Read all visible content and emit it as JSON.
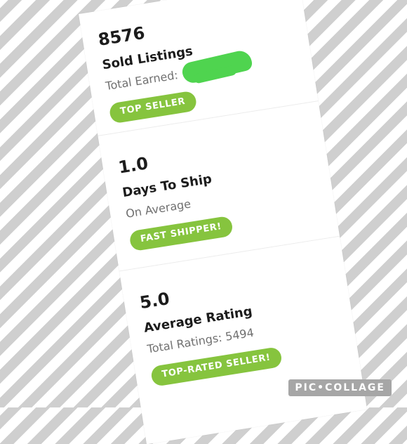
{
  "stats": [
    {
      "value": "8576",
      "title": "Sold Listings",
      "subtitle": "Total Earned:",
      "badge": "TOP SELLER"
    },
    {
      "value": "1.0",
      "title": "Days To Ship",
      "subtitle": "On Average",
      "badge": "FAST SHIPPER!"
    },
    {
      "value": "5.0",
      "title": "Average Rating",
      "subtitle": "Total Ratings: 5494",
      "badge": "TOP-RATED SELLER!"
    }
  ],
  "watermark": "PIC•COLLAGE",
  "colors": {
    "badge_green": "#86c43e",
    "redaction_green": "#4fd44f",
    "stripe_gray": "#cfcfcf"
  }
}
